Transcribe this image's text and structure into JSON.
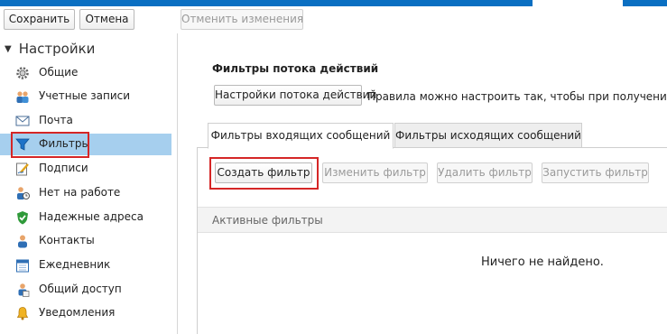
{
  "toolbar": {
    "save_label": "Сохранить",
    "cancel_label": "Отмена",
    "undo_label": "Отменить изменения"
  },
  "sidebar": {
    "title": "Настройки",
    "items": [
      {
        "label": "Общие",
        "icon": "gear-icon"
      },
      {
        "label": "Учетные записи",
        "icon": "accounts-icon"
      },
      {
        "label": "Почта",
        "icon": "mail-icon"
      },
      {
        "label": "Фильтры",
        "icon": "filter-icon",
        "selected": true
      },
      {
        "label": "Подписи",
        "icon": "signature-icon"
      },
      {
        "label": "Нет на работе",
        "icon": "out-of-office-icon"
      },
      {
        "label": "Надежные адреса",
        "icon": "shield-icon"
      },
      {
        "label": "Контакты",
        "icon": "contacts-icon"
      },
      {
        "label": "Ежедневник",
        "icon": "calendar-icon"
      },
      {
        "label": "Общий доступ",
        "icon": "sharing-icon"
      },
      {
        "label": "Уведомления",
        "icon": "bell-icon"
      }
    ]
  },
  "main": {
    "section_title": "Фильтры потока действий",
    "settings_button": "Настройки потока действий",
    "description": "Правила можно настроить так, чтобы при получении менее",
    "tabs": [
      {
        "label": "Фильтры входящих сообщений",
        "active": true
      },
      {
        "label": "Фильтры исходящих сообщений",
        "active": false
      }
    ],
    "actions": {
      "create": "Создать фильтр",
      "edit": "Изменить фильтр",
      "delete": "Удалить фильтр",
      "run": "Запустить фильтр"
    },
    "list_header": "Активные фильтры",
    "empty_text": "Ничего не найдено."
  },
  "colors": {
    "accent": "#0a6fc2",
    "selected_bg": "#a6cfee",
    "highlight_red": "#d52626"
  }
}
